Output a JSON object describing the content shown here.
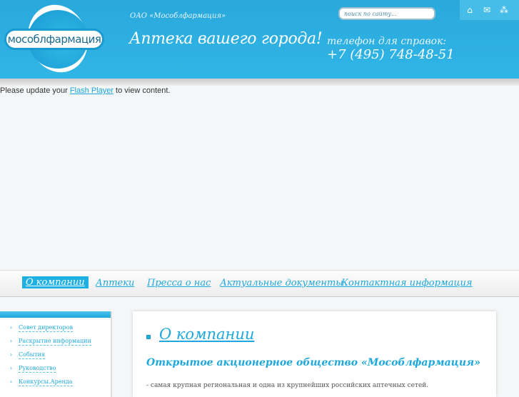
{
  "header": {
    "logo_text": "мособлфармация",
    "company": "ОАО «Мособлфармация»",
    "slogan": "Аптека вашего города!",
    "phone_label": "телефон для справок:",
    "phone": "+7 (495) 748-48-51",
    "search_placeholder": "поиск по сайту...",
    "icons": [
      "home-icon",
      "mail-icon",
      "sitemap-icon"
    ]
  },
  "flash": {
    "before": "Please update your ",
    "link": "Flash Player",
    "after": " to view content."
  },
  "nav": [
    "О компании",
    "Аптеки",
    "Пресса о нас",
    "Актуальные документы",
    "Контактная информация"
  ],
  "sidebar": [
    "Совет директоров",
    "Раскрытие информации",
    "События",
    "Руководство",
    "Конкурсы.Аренда"
  ],
  "main": {
    "title": "О компании",
    "subtitle": "Открытое акционерное общество «Мособлфармация»",
    "text": "- самая крупная региональная и одна из крупнейших российских аптечных сетей."
  }
}
